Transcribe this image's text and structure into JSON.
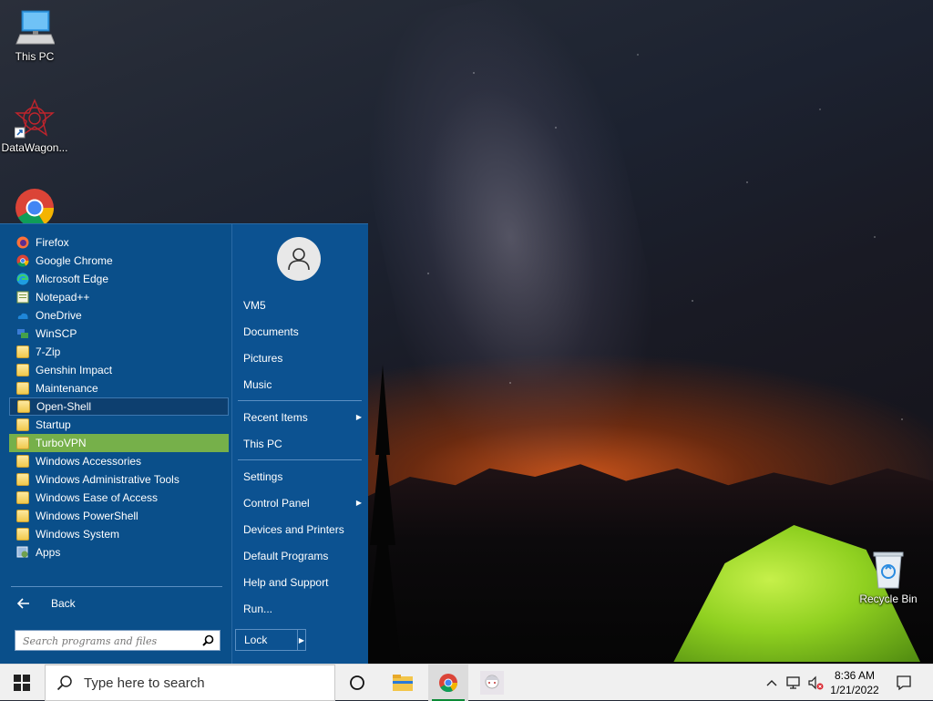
{
  "desktop": {
    "icons": [
      {
        "label": "This PC"
      },
      {
        "label": "DataWagon..."
      },
      {
        "label": "Recycle Bin"
      }
    ]
  },
  "start_menu": {
    "programs": [
      {
        "label": "Firefox",
        "icon": "firefox-icon"
      },
      {
        "label": "Google Chrome",
        "icon": "chrome-icon"
      },
      {
        "label": "Microsoft Edge",
        "icon": "edge-icon"
      },
      {
        "label": "Notepad++",
        "icon": "notepadpp-icon"
      },
      {
        "label": "OneDrive",
        "icon": "onedrive-icon"
      },
      {
        "label": "WinSCP",
        "icon": "winscp-icon"
      },
      {
        "label": "7-Zip",
        "icon": "folder-icon"
      },
      {
        "label": "Genshin Impact",
        "icon": "folder-icon"
      },
      {
        "label": "Maintenance",
        "icon": "folder-icon"
      },
      {
        "label": "Open-Shell",
        "icon": "folder-icon"
      },
      {
        "label": "Startup",
        "icon": "folder-icon"
      },
      {
        "label": "TurboVPN",
        "icon": "folder-icon"
      },
      {
        "label": "Windows Accessories",
        "icon": "folder-icon"
      },
      {
        "label": "Windows Administrative Tools",
        "icon": "folder-icon"
      },
      {
        "label": "Windows Ease of Access",
        "icon": "folder-icon"
      },
      {
        "label": "Windows PowerShell",
        "icon": "folder-icon"
      },
      {
        "label": "Windows System",
        "icon": "folder-icon"
      },
      {
        "label": "Apps",
        "icon": "apps-icon"
      }
    ],
    "back_label": "Back",
    "search_placeholder": "Search programs and files",
    "user_name": "VM5",
    "right_links": {
      "documents": "Documents",
      "pictures": "Pictures",
      "music": "Music",
      "recent_items": "Recent Items",
      "this_pc": "This PC",
      "settings": "Settings",
      "control_panel": "Control Panel",
      "devices_printers": "Devices and Printers",
      "default_programs": "Default Programs",
      "help_support": "Help and Support",
      "run": "Run..."
    },
    "lock_label": "Lock"
  },
  "taskbar": {
    "search_text": "Type here to search",
    "time": "8:36 AM",
    "date": "1/21/2022"
  },
  "colors": {
    "start_bg": "#0a4f8a",
    "selected": "#76b04a",
    "taskbar": "#f0f0f0"
  }
}
